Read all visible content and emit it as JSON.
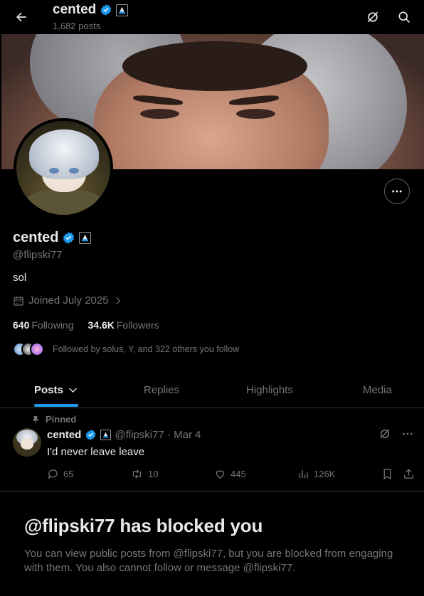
{
  "header": {
    "name": "cented",
    "posts_count": "1,682 posts"
  },
  "profile": {
    "name": "cented",
    "handle": "@flipski77",
    "bio": "sol",
    "joined": "Joined July 2025",
    "following_count": "640",
    "following_label": "Following",
    "followers_count": "34.6K",
    "followers_label": "Followers",
    "followed_by": "Followed by solus, Y, and 322 others you follow"
  },
  "tabs": [
    {
      "label": "Posts"
    },
    {
      "label": "Replies"
    },
    {
      "label": "Highlights"
    },
    {
      "label": "Media"
    }
  ],
  "pinned_post": {
    "pinned_label": "Pinned",
    "author": "cented",
    "meta": "@flipski77 · Mar 4",
    "text": "I'd never leave leave",
    "replies": "65",
    "reposts": "10",
    "likes": "445",
    "views": "126K"
  },
  "blocked": {
    "title": "@flipski77 has blocked you",
    "message": "You can view public posts from @flipski77, but you are blocked from engaging with them. You also cannot follow or message @flipski77."
  },
  "colors": {
    "accent": "#1d9bf0",
    "muted": "#71767b",
    "text": "#e7e9ea",
    "divider": "#2f3336"
  },
  "icons": [
    "back-arrow-icon",
    "grok-icon",
    "search-icon",
    "more-icon",
    "verified-icon",
    "affiliate-badge-icon",
    "calendar-icon",
    "chevron-right-icon",
    "chevron-down-icon",
    "pin-icon",
    "reply-icon",
    "repost-icon",
    "like-icon",
    "views-icon",
    "bookmark-icon",
    "share-icon"
  ]
}
